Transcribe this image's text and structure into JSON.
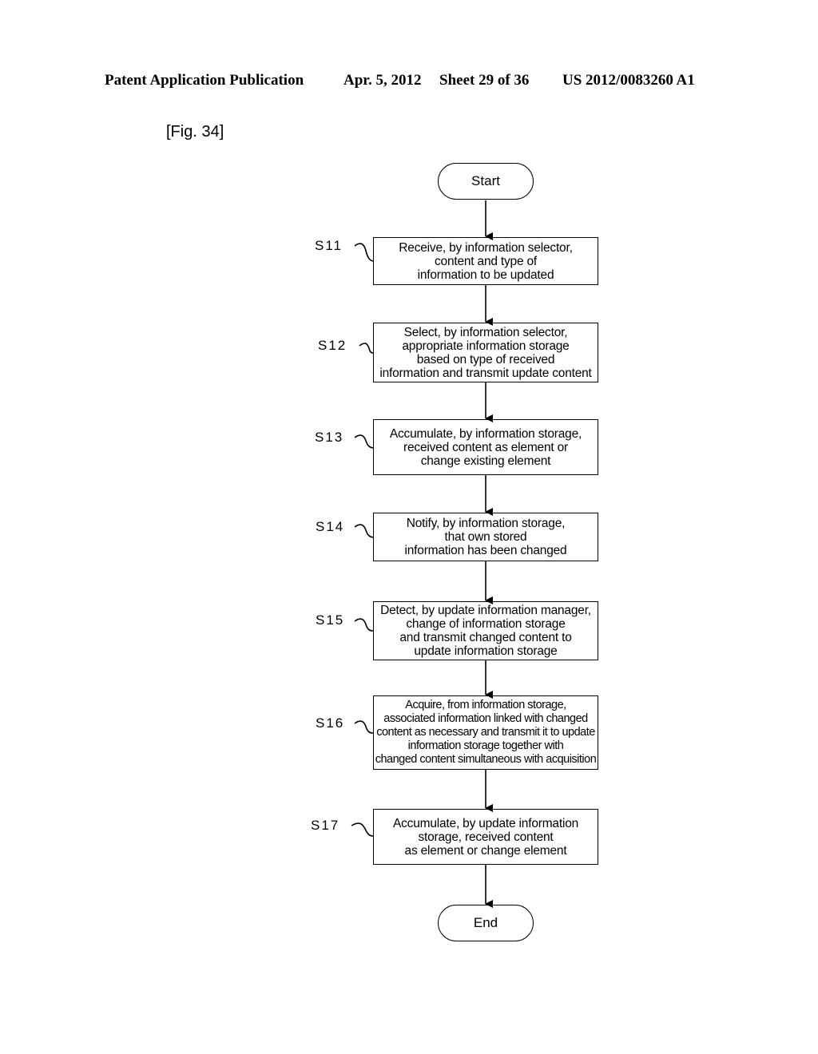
{
  "header": {
    "publication": "Patent Application Publication",
    "date": "Apr. 5, 2012",
    "sheet": "Sheet 29 of 36",
    "number": "US 2012/0083260 A1"
  },
  "figure_label": "[Fig. 34]",
  "flowchart": {
    "start": "Start",
    "end": "End",
    "steps": [
      {
        "id": "S11",
        "text": "Receive, by information selector,\ncontent and type of\ninformation to be updated"
      },
      {
        "id": "S12",
        "text": "Select, by information selector,\nappropriate information storage\nbased on type of received\ninformation and transmit update content"
      },
      {
        "id": "S13",
        "text": "Accumulate, by information storage,\nreceived content as element or\nchange existing element"
      },
      {
        "id": "S14",
        "text": "Notify, by information storage,\nthat own stored\ninformation has been changed"
      },
      {
        "id": "S15",
        "text": "Detect, by update information manager,\nchange of information storage\nand transmit changed content to\nupdate information storage"
      },
      {
        "id": "S16",
        "text": "Acquire, from information storage,\nassociated information linked with changed\ncontent as necessary and transmit it to update\ninformation storage together with\nchanged content simultaneous with acquisition"
      },
      {
        "id": "S17",
        "text": "Accumulate, by update information\nstorage, received content\nas element or change element"
      }
    ]
  }
}
